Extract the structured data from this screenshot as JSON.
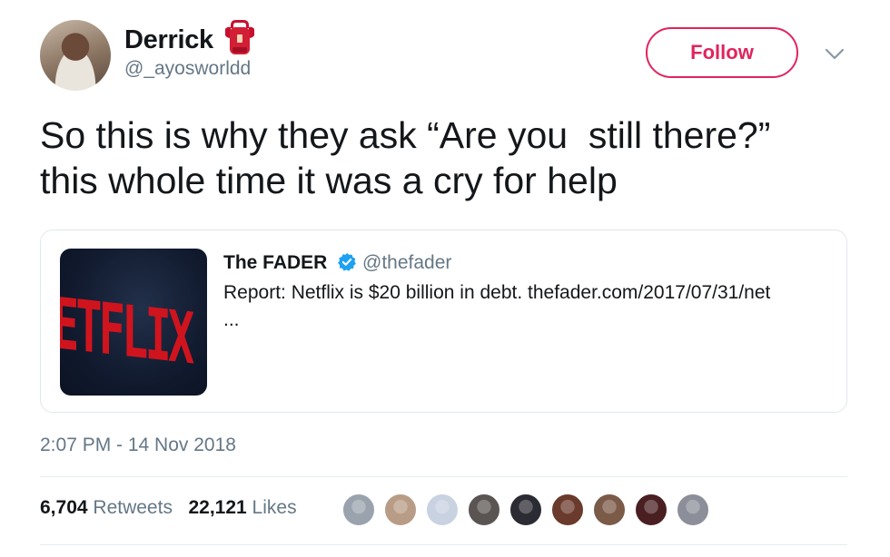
{
  "author": {
    "display_name": "Derrick",
    "handle": "@_ayosworldd",
    "name_emoji": "backpack-emoji"
  },
  "actions": {
    "follow_label": "Follow",
    "menu_icon": "chevron-down-icon"
  },
  "tweet": {
    "text": "So this is why they ask “Are you  still there?”\nthis whole time it was a cry for help"
  },
  "quoted_tweet": {
    "author_name": "The FADER",
    "verified": true,
    "handle": "@thefader",
    "text": "Report: Netflix is $20 billion in debt. thefader.com/2017/07/31/net",
    "ellipsis": "...",
    "thumbnail_text": "ETFLIX"
  },
  "timestamp": "2:07 PM - 14 Nov 2018",
  "stats": {
    "retweets_count": "6,704",
    "retweets_label": "Retweets",
    "likes_count": "22,121",
    "likes_label": "Likes"
  },
  "likers": [
    {
      "color": "#9aa3ad"
    },
    {
      "color": "#b89c86"
    },
    {
      "color": "#c9d2e0"
    },
    {
      "color": "#5a5552"
    },
    {
      "color": "#2b2b33"
    },
    {
      "color": "#6a3a2c"
    },
    {
      "color": "#7b5a48"
    },
    {
      "color": "#4a1f22"
    },
    {
      "color": "#8c8f99"
    }
  ],
  "colors": {
    "follow_accent": "#e0245e",
    "verified_blue": "#1da1f2",
    "muted_text": "#657786",
    "divider": "#e6ecf0"
  }
}
